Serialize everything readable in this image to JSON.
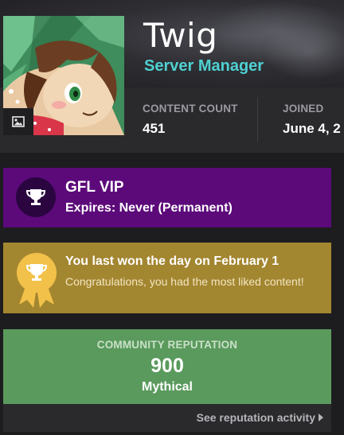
{
  "profile": {
    "username": "Twig",
    "usergroup": "Server Manager",
    "usergroup_color": "#4fd1d1"
  },
  "stats": [
    {
      "label": "CONTENT COUNT",
      "value": "451"
    },
    {
      "label": "JOINED",
      "value": "June 4, 2"
    }
  ],
  "avatar": {
    "change_icon": "image-icon"
  },
  "vip": {
    "title": "GFL VIP",
    "subtitle": "Expires: Never (Permanent)",
    "icon": "trophy-icon",
    "color": "#5c0a7a"
  },
  "day_winner": {
    "title": "You last won the day on February 1",
    "description": "Congratulations, you had the most liked content!",
    "icon": "trophy-ribbon-icon",
    "color": "#a38630"
  },
  "reputation": {
    "label": "COMMUNITY REPUTATION",
    "value": "900",
    "title": "Mythical",
    "color": "#5a9a5d",
    "link_text": "See reputation activity",
    "link_icon": "chevron-right-icon"
  }
}
